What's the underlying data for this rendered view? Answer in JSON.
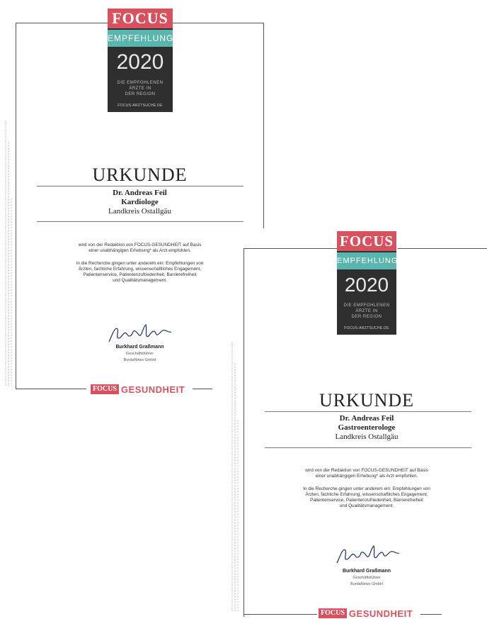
{
  "certificates": [
    {
      "badge": {
        "logo": "FOCUS",
        "label": "EMPFEHLUNG",
        "year": "2020",
        "subtitle_1": "DIE EMPFOHLENEN",
        "subtitle_2": "ÄRZTE IN",
        "subtitle_3": "DER REGION",
        "url": "FOCUS-ARZTSUCHE.DE"
      },
      "title": "URKUNDE",
      "doctor_name": "Dr. Andreas Feil",
      "specialty": "Kardiologe",
      "region": "Landkreis Ostallgäu",
      "body_line_1": "wird von der Redaktion von FOCUS-GESUNDHEIT auf Basis",
      "body_line_2": "einer unabhängigen Erhebung* als Arzt empfohlen.",
      "body_line_3": "In die Recherche gingen unter anderem ein: Empfehlungen von",
      "body_line_4": "Ärzten, fachliche Erfahrung, wissenschaftliches Engagement,",
      "body_line_5": "Patientenservice, Patientenzufriedenheit, Barrierefreiheit",
      "body_line_6": "und Qualitätsmanagement.",
      "signer": "Burkhard Graßmann",
      "signer_role": "Geschäftsführer",
      "company": "BurdaNews GmbH",
      "footer_logo": "FOCUS",
      "footer_text": "GESUNDHEIT"
    },
    {
      "badge": {
        "logo": "FOCUS",
        "label": "EMPFEHLUNG",
        "year": "2020",
        "subtitle_1": "DIE EMPFOHLENEN",
        "subtitle_2": "ÄRZTE IN",
        "subtitle_3": "DER REGION",
        "url": "FOCUS-ARZTSUCHE.DE"
      },
      "title": "URKUNDE",
      "doctor_name": "Dr. Andreas Feil",
      "specialty": "Gastroenterologe",
      "region": "Landkreis Ostallgäu",
      "body_line_1": "wird von der Redaktion von FOCUS-GESUNDHEIT auf Basis",
      "body_line_2": "einer unabhängigen Erhebung* als Arzt empfohlen.",
      "body_line_3": "In die Recherche gingen unter anderem ein: Empfehlungen von",
      "body_line_4": "Ärzten, fachliche Erfahrung, wissenschaftliches Engagement,",
      "body_line_5": "Patientenservice, Patientenzufriedenheit, Barrierefreiheit",
      "body_line_6": "und Qualitätsmanagement.",
      "signer": "Burkhard Graßmann",
      "signer_role": "Geschäftsführer",
      "company": "BurdaNews GmbH",
      "footer_logo": "FOCUS",
      "footer_text": "GESUNDHEIT"
    }
  ]
}
